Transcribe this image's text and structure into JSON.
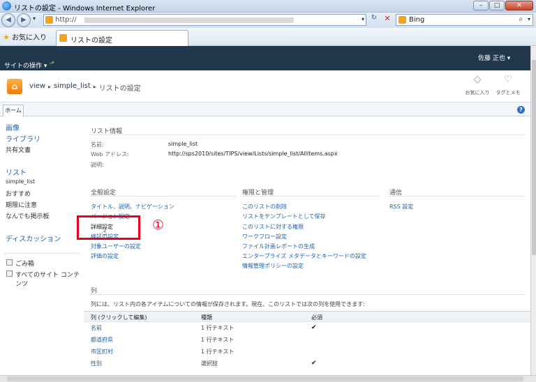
{
  "browser": {
    "title": "リストの設定 - Windows Internet Explorer",
    "address": "http://",
    "search_engine": "Bing",
    "favorites_label": "お気に入り",
    "tab_label": "リストの設定",
    "buttons": {
      "minimize": "–",
      "restore": "□",
      "close": "✕"
    }
  },
  "sp": {
    "site_actions": "サイトの操作 ▾",
    "user": "佐藤 正也 ▾",
    "breadcrumb": [
      "view",
      "simple_list",
      "リストの設定"
    ],
    "tool_like": "お気に入り",
    "tool_tag": "タグとメモ",
    "home_tab": "ホーム"
  },
  "leftnav": {
    "images": "画像",
    "libraries": "ライブラリ",
    "shared_docs": "共有文書",
    "lists": "リスト",
    "simple_list": "simple_list",
    "recommend": "おすすめ",
    "due": "期限に注意",
    "board": "なんでも掲示板",
    "discussion": "ディスカッション",
    "recycle": "ごみ箱",
    "all_content": "すべてのサイト コンテンツ"
  },
  "info": {
    "heading": "リスト情報",
    "name_label": "名前:",
    "name_value": "simple_list",
    "web_label": "Web アドレス:",
    "web_value": "http://sps2010/sites/TIPS/view/Lists/simple_list/AllItems.aspx",
    "desc_label": "説明:"
  },
  "general": {
    "heading": "全般設定",
    "items": [
      "タイトル、説明、ナビゲーション",
      "バージョン設定",
      "詳細設定",
      "検証の設定",
      "対象ユーザーの設定",
      "評価の設定"
    ]
  },
  "perm": {
    "heading": "権限と管理",
    "items": [
      "このリストの削除",
      "リストをテンプレートとして保存",
      "このリストに対する権限",
      "ワークフロー設定",
      "ファイル計画レポートの生成",
      "エンタープライズ メタデータとキーワードの設定",
      "情報管理ポリシーの設定"
    ]
  },
  "comm": {
    "heading": "通信",
    "items": [
      "RSS 設定"
    ]
  },
  "annotation": {
    "number": "①"
  },
  "columns": {
    "heading": "列",
    "description": "列には、リスト内の各アイテムについての情報が保存されます。現在、このリストでは次の列を使用できます:",
    "headers": [
      "列 (クリックして編集)",
      "種類",
      "必須"
    ],
    "rows": [
      {
        "name": "名前",
        "type": "1 行テキスト",
        "req": "✔"
      },
      {
        "name": "都道府県",
        "type": "1 行テキスト",
        "req": ""
      },
      {
        "name": "市区町村",
        "type": "1 行テキスト",
        "req": ""
      },
      {
        "name": "性別",
        "type": "選択肢",
        "req": "✔"
      }
    ]
  }
}
